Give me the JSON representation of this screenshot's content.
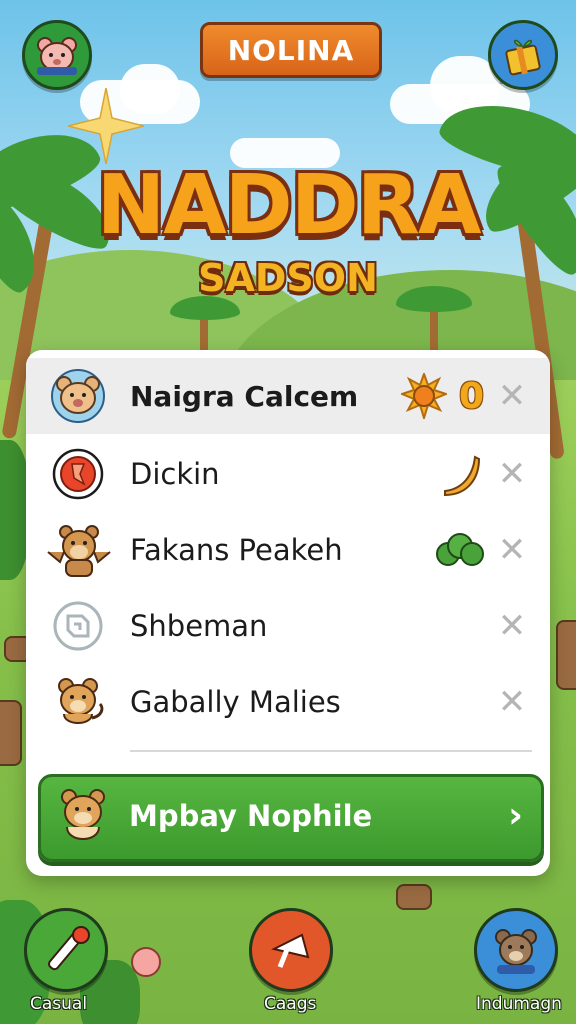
{
  "header": {
    "level_badge": "NOLINA",
    "profile_icon": "bear-face-icon",
    "shop_icon": "gift-box-icon"
  },
  "title": {
    "main": "NADDRA",
    "sub": "SADSON"
  },
  "player_list": [
    {
      "name": "Naigra Calcem",
      "avatar": "bear-avatar-icon",
      "highlight": true,
      "item_icon": "sun-icon",
      "count": "0"
    },
    {
      "name": "Dickin",
      "avatar": "shield-emblem-icon",
      "highlight": false,
      "item_icon": "banana-icon"
    },
    {
      "name": "Fakans Peakeh",
      "avatar": "monkey-avatar-icon",
      "highlight": false,
      "item_icon": "bush-icon"
    },
    {
      "name": "Shbeman",
      "avatar": "rune-emblem-icon",
      "highlight": false,
      "item_icon": ""
    },
    {
      "name": "Gabally Malies",
      "avatar": "fox-avatar-icon",
      "highlight": false,
      "item_icon": ""
    }
  ],
  "play_button": {
    "label": "Mpbay Nophile",
    "avatar": "fox-avatar-icon",
    "chevron": "›"
  },
  "bottom_nav": {
    "left_label": "Casual",
    "center_label": "Caags",
    "right_label": "Indumagn"
  },
  "colors": {
    "accent_orange": "#e97a24",
    "play_green": "#4aa838",
    "title_orange": "#f7a21b"
  }
}
